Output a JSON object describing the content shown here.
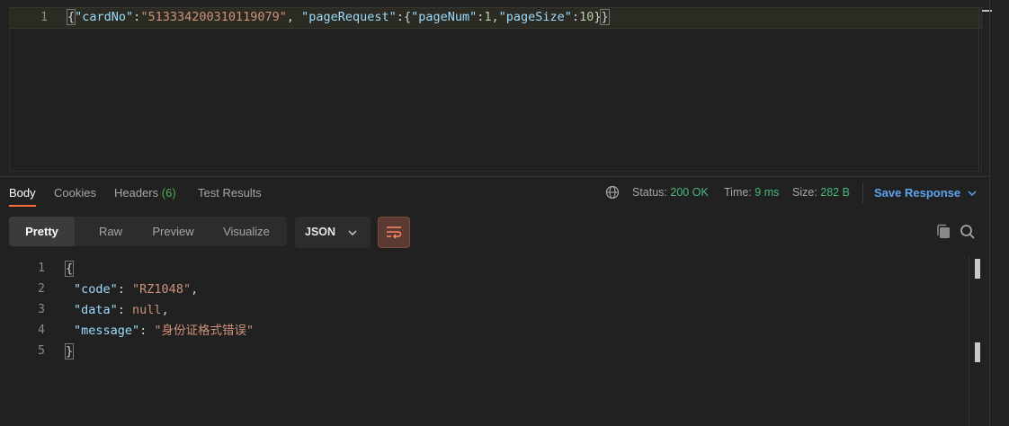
{
  "request_editor": {
    "line_number": "1",
    "json": {
      "open": "{",
      "k1": "\"cardNo\"",
      "c1": ":",
      "v1": "\"513334200310119079\"",
      "sep1": ", ",
      "k2": "\"pageRequest\"",
      "c2": ":{",
      "k3": "\"pageNum\"",
      "c3": ":",
      "v3": "1",
      "sep3": ",",
      "k4": "\"pageSize\"",
      "c4": ":",
      "v4": "10",
      "close_inner": "}",
      "close": "}"
    }
  },
  "response_tabs": {
    "body": "Body",
    "cookies": "Cookies",
    "headers": "Headers",
    "headers_count": "(6)",
    "test_results": "Test Results"
  },
  "status": {
    "status_label": "Status:",
    "status_value": "200 OK",
    "time_label": "Time:",
    "time_value": "9 ms",
    "size_label": "Size:",
    "size_value": "282 B",
    "save_response": "Save Response"
  },
  "format_toolbar": {
    "pretty": "Pretty",
    "raw": "Raw",
    "preview": "Preview",
    "visualize": "Visualize",
    "language": "JSON"
  },
  "response_body": {
    "line_numbers": [
      "1",
      "2",
      "3",
      "4",
      "5"
    ],
    "open_brace": "{",
    "code_key": "\"code\"",
    "code_value": "\"RZ1048\"",
    "data_key": "\"data\"",
    "data_value": "null",
    "message_key": "\"message\"",
    "message_value": "\"身份证格式错误\"",
    "colon": ": ",
    "comma": ",",
    "close_brace": "}"
  },
  "colors": {
    "accent_orange": "#ff6c37",
    "status_green": "#49b97a",
    "link_blue": "#5ea3f0",
    "json_key": "#9cdcfe",
    "json_string": "#ce9178",
    "json_number": "#b5cea8"
  }
}
